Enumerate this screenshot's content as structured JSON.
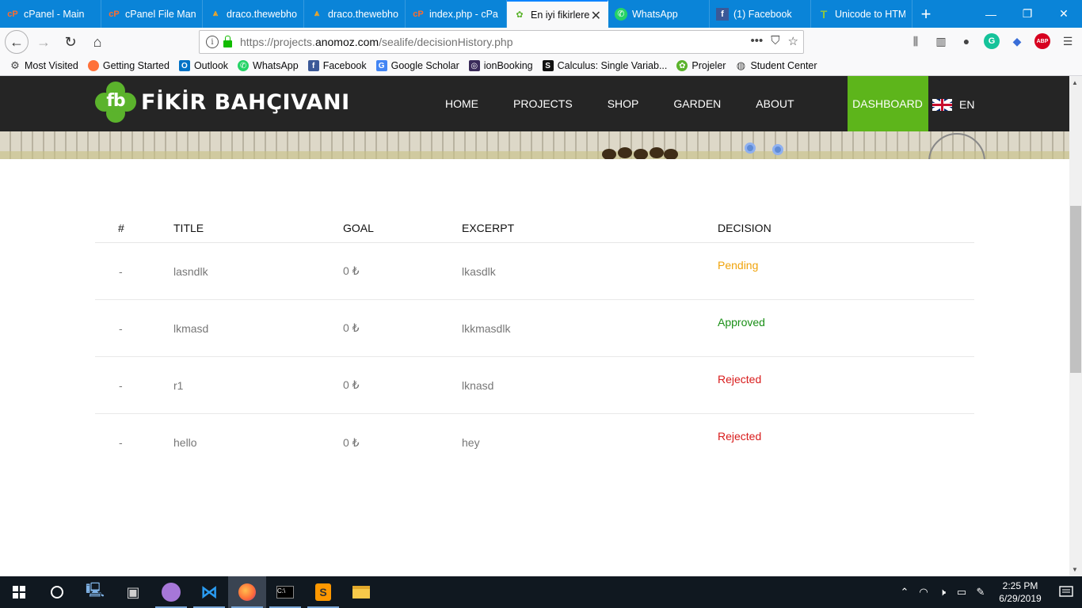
{
  "browser": {
    "tabs": [
      {
        "label": "cPanel - Main",
        "icon": "cpanel-icon",
        "active": false
      },
      {
        "label": "cPanel File Mana",
        "icon": "cpanel-icon",
        "active": false
      },
      {
        "label": "draco.thewebho",
        "icon": "webhost-icon",
        "active": false
      },
      {
        "label": "draco.thewebho",
        "icon": "webhost-icon",
        "active": false
      },
      {
        "label": "index.php - cPa",
        "icon": "cpanel-icon",
        "active": false
      },
      {
        "label": "En iyi fikirlere",
        "icon": "clover-icon",
        "active": true
      },
      {
        "label": "WhatsApp",
        "icon": "whatsapp-icon",
        "active": false
      },
      {
        "label": "(1) Facebook",
        "icon": "facebook-icon",
        "active": false
      },
      {
        "label": "Unicode to HTM",
        "icon": "unicode-icon",
        "active": false
      }
    ],
    "url_prefix": "https://projects.",
    "url_domain": "anomoz.com",
    "url_path": "/sealife/decisionHistory.php",
    "bookmarks": [
      {
        "label": "Most Visited",
        "icon": "gear-icon"
      },
      {
        "label": "Getting Started",
        "icon": "firefox-icon"
      },
      {
        "label": "Outlook",
        "icon": "outlook-icon"
      },
      {
        "label": "WhatsApp",
        "icon": "whatsapp-icon"
      },
      {
        "label": "Facebook",
        "icon": "facebook-icon"
      },
      {
        "label": "Google Scholar",
        "icon": "scholar-icon"
      },
      {
        "label": "ionBooking",
        "icon": "ion-icon"
      },
      {
        "label": "Calculus: Single Variab...",
        "icon": "coursera-icon"
      },
      {
        "label": "Projeler",
        "icon": "clover-icon"
      },
      {
        "label": "Student Center",
        "icon": "globe-icon"
      }
    ]
  },
  "site": {
    "brand": "FİKİR BAHÇIVANI",
    "logo_mark": "fb",
    "nav": [
      "HOME",
      "PROJECTS",
      "SHOP",
      "GARDEN",
      "ABOUT",
      "DASHBOARD"
    ],
    "lang": "EN"
  },
  "table": {
    "headers": [
      "#",
      "TITLE",
      "GOAL",
      "EXCERPT",
      "DECISION"
    ],
    "rows": [
      {
        "num": "-",
        "title": "lasndlk",
        "goal": "0 ₺",
        "excerpt": "lkasdlk",
        "decision": "Pending"
      },
      {
        "num": "-",
        "title": "lkmasd",
        "goal": "0 ₺",
        "excerpt": "lkkmasdlk",
        "decision": "Approved"
      },
      {
        "num": "-",
        "title": "r1",
        "goal": "0 ₺",
        "excerpt": "lknasd",
        "decision": "Rejected"
      },
      {
        "num": "-",
        "title": "hello",
        "goal": "0 ₺",
        "excerpt": "hey",
        "decision": "Rejected"
      }
    ]
  },
  "colors": {
    "accent": "#5db51b",
    "pending": "#f0a30a",
    "approved": "#1a8f17",
    "rejected": "#d81b1b"
  },
  "taskbar": {
    "time": "2:25 PM",
    "date": "6/29/2019"
  }
}
